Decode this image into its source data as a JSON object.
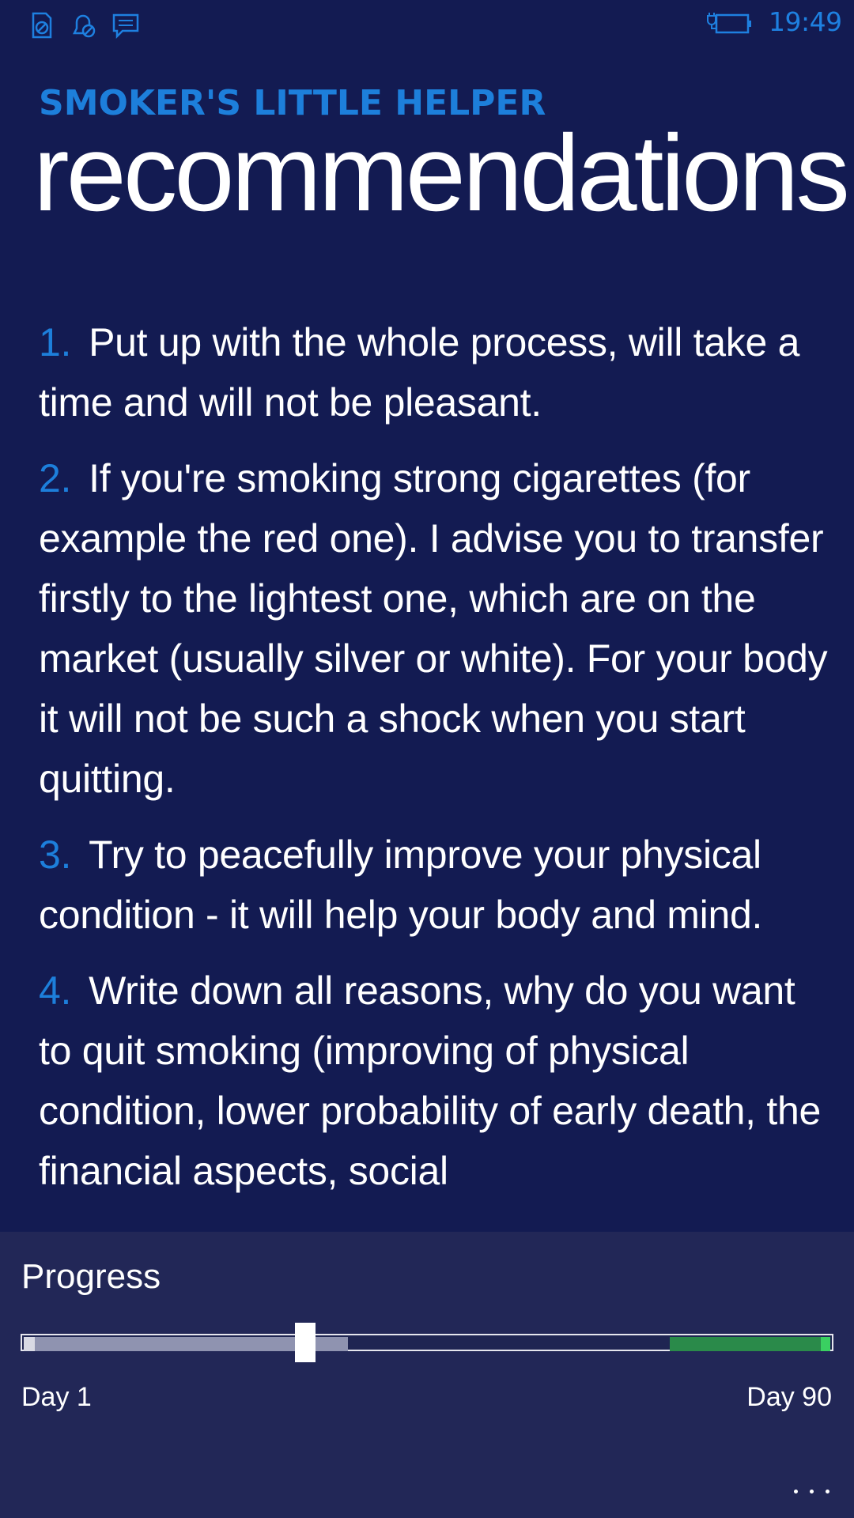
{
  "status_bar": {
    "icons": [
      "sim-icon",
      "no-ringer-icon",
      "message-icon"
    ],
    "battery_icon": "battery-charging-icon",
    "time": "19:49"
  },
  "header": {
    "app_title": "SMOKER'S LITTLE HELPER",
    "page_title": "recommendations"
  },
  "recommendations": [
    {
      "number": "1.",
      "text": "Put up with the whole process, will take a time and will not be pleasant."
    },
    {
      "number": "2.",
      "text": "If you're smoking strong cigarettes (for example the red one). I advise you to transfer firstly to the lightest one, which are on the market (usually silver or white). For your body it will not be such a shock when you start quitting."
    },
    {
      "number": "3.",
      "text": "Try to peacefully improve your physical condition - it will help your body and mind."
    },
    {
      "number": "4.",
      "text": "Write down all reasons, why do you want to quit smoking (improving of physical condition, lower probability of early death, the financial aspects, social"
    }
  ],
  "app_bar": {
    "progress_label": "Progress",
    "slider": {
      "thumb_fraction": 0.35,
      "fill_fraction": 0.4,
      "green_start_fraction": 0.8
    },
    "day_start": "Day 1",
    "day_end": "Day 90",
    "more_icon": "ellipsis-icon"
  },
  "colors": {
    "background": "#131b52",
    "app_bar": "#222757",
    "accent": "#1d7fdb",
    "green": "#2a8a4a"
  }
}
